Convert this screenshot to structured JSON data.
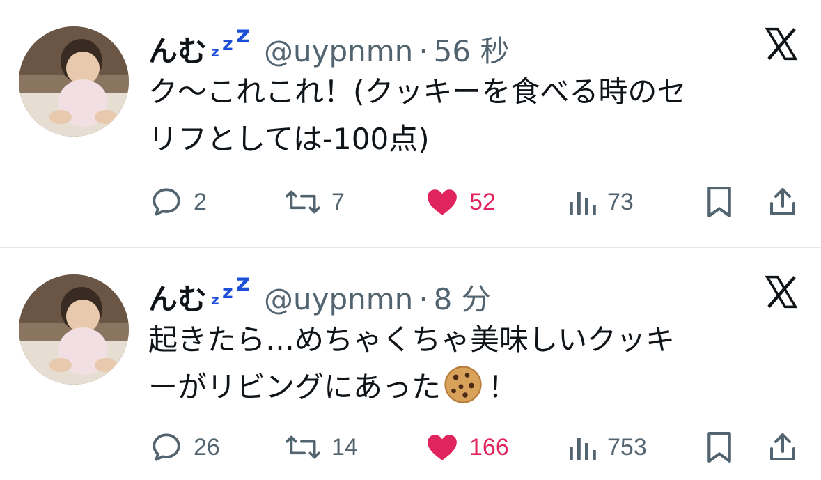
{
  "tweets": [
    {
      "name": "んむ",
      "zzz": [
        "z",
        "z",
        "z"
      ],
      "handle": "@uypnmn",
      "separator": "·",
      "time": "56 秒",
      "text_lines": [
        "ク〜これこれ！(クッキーを食べる時のセ",
        "リフとしては-100点)"
      ],
      "replies": "2",
      "retweets": "7",
      "likes": "52",
      "views": "73",
      "liked": true
    },
    {
      "name": "んむ",
      "zzz": [
        "z",
        "z",
        "z"
      ],
      "handle": "@uypnmn",
      "separator": "·",
      "time": "8 分",
      "text_lines": [
        "起きたら…めちゃくちゃ美味しいクッキ",
        "ーがリビングにあった",
        "！"
      ],
      "replies": "26",
      "retweets": "14",
      "likes": "166",
      "views": "753",
      "liked": true
    }
  ],
  "icons": {
    "avatar": "baby-photo-avatar",
    "platform": "x-logo-icon",
    "reply": "reply-icon",
    "retweet": "retweet-icon",
    "like": "heart-icon",
    "views": "views-icon",
    "bookmark": "bookmark-icon",
    "share": "share-icon",
    "emoji": "cookie-emoji-icon"
  },
  "colors": {
    "text": "#0f1419",
    "secondary": "#536471",
    "like": "#e0245e",
    "zzz": "#1d4ed8",
    "divider": "#e6e6e6"
  }
}
